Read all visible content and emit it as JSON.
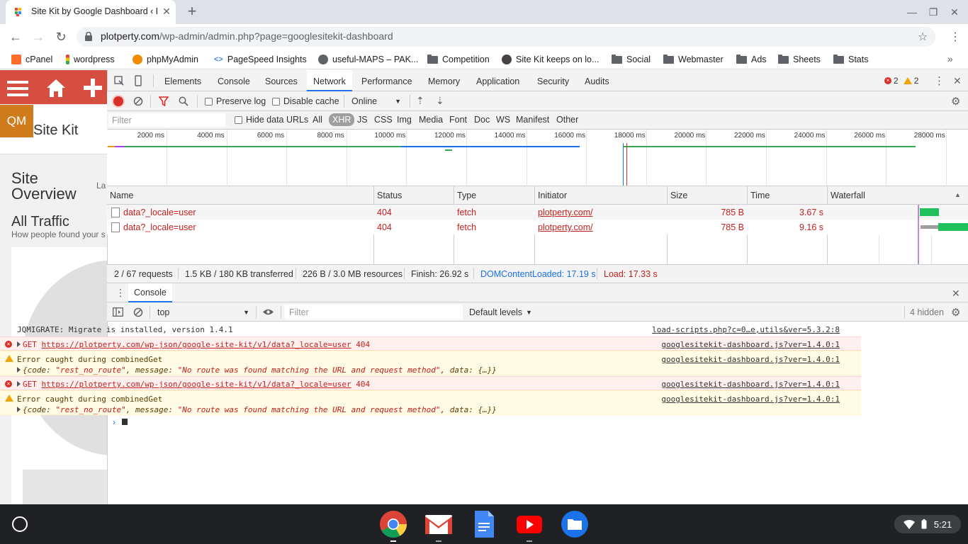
{
  "browser": {
    "tab_title": "Site Kit by Google Dashboard ‹ P",
    "url_host": "plotperty.com",
    "url_path": "/wp-admin/admin.php?page=googlesitekit-dashboard",
    "bookmarks": [
      "cPanel",
      "wordpress",
      "phpMyAdmin",
      "PageSpeed Insights",
      "useful-MAPS – PAK...",
      "Competition",
      "Site Kit keeps on lo...",
      "Social",
      "Webmaster",
      "Ads",
      "Sheets",
      "Stats"
    ]
  },
  "wordpress": {
    "qm_label": "QM",
    "plugin_name": "Site Kit",
    "page_title_line1": "Site",
    "page_title_line2": "Overview",
    "la_label": "La",
    "section_title": "All Traffic",
    "section_subtitle": "How people found your s"
  },
  "devtools": {
    "tabs": [
      "Elements",
      "Console",
      "Sources",
      "Network",
      "Performance",
      "Memory",
      "Application",
      "Security",
      "Audits"
    ],
    "active_tab": "Network",
    "error_count": "2",
    "warning_count": "2",
    "network_toolbar": {
      "preserve_log": "Preserve log",
      "disable_cache": "Disable cache",
      "throttle": "Online"
    },
    "filter": {
      "placeholder": "Filter",
      "hide_data_urls": "Hide data URLs",
      "types": [
        "All",
        "XHR",
        "JS",
        "CSS",
        "Img",
        "Media",
        "Font",
        "Doc",
        "WS",
        "Manifest",
        "Other"
      ],
      "active_type": "XHR"
    },
    "timeline_ticks": [
      "2000 ms",
      "4000 ms",
      "6000 ms",
      "8000 ms",
      "10000 ms",
      "12000 ms",
      "14000 ms",
      "16000 ms",
      "18000 ms",
      "20000 ms",
      "22000 ms",
      "24000 ms",
      "26000 ms",
      "28000 ms"
    ],
    "columns": [
      "Name",
      "Status",
      "Type",
      "Initiator",
      "Size",
      "Time",
      "Waterfall"
    ],
    "requests": [
      {
        "name": "data?_locale=user",
        "status": "404",
        "type": "fetch",
        "initiator": "plotperty.com/",
        "size": "785 B",
        "time": "3.67 s"
      },
      {
        "name": "data?_locale=user",
        "status": "404",
        "type": "fetch",
        "initiator": "plotperty.com/",
        "size": "785 B",
        "time": "9.16 s"
      }
    ],
    "summary": {
      "requests": "2 / 67 requests",
      "transferred": "1.5 KB / 180 KB transferred",
      "resources": "226 B / 3.0 MB resources",
      "finish": "Finish: 26.92 s",
      "domcontentloaded": "DOMContentLoaded: 17.19 s",
      "load": "Load: 17.33 s"
    },
    "drawer_tab": "Console",
    "console_toolbar": {
      "context": "top",
      "filter_placeholder": "Filter",
      "levels": "Default levels",
      "hidden": "4 hidden"
    },
    "console": {
      "l1_text": "JQMIGRATE: Migrate is installed, version 1.4.1",
      "l1_src": "load-scripts.php?c=0…e,utils&ver=5.3.2:8",
      "get_method": "GET",
      "get_url": "https://plotperty.com/wp-json/google-site-kit/v1/data?_locale=user",
      "get_status": "404",
      "err_src": "googlesitekit-dashboard.js?ver=1.4.0:1",
      "warn_text": "Error caught during combinedGet",
      "obj_code_key": "code",
      "obj_code_val": "\"rest_no_route\"",
      "obj_msg_key": "message",
      "obj_msg_val": "\"No route was found matching the URL and request method\"",
      "obj_data": "data: {…}}"
    }
  },
  "shelf": {
    "time": "5:21"
  }
}
